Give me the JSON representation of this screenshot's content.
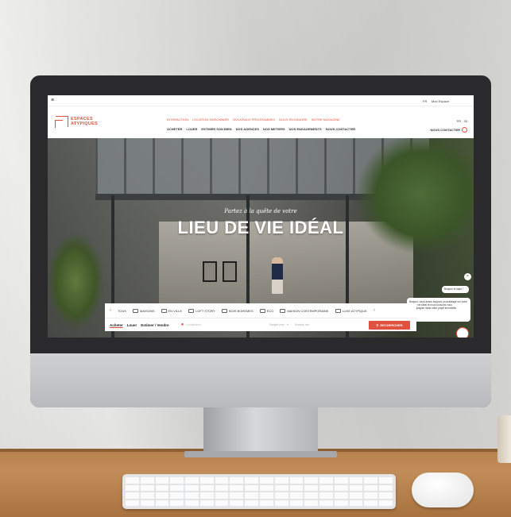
{
  "colors": {
    "brand": "#e0523f"
  },
  "util_bar": {
    "menu_icon": "hamburger-icon",
    "lang": "FR",
    "space": "Mon Espace"
  },
  "logo": {
    "line1": "ESPACES",
    "line2": "ATYPIQUES"
  },
  "nav_top": [
    "INTERACTION",
    "LOCATION SAISONNIER",
    "NOUVEAUX PROGRAMMES",
    "NOUS REJOINDRE",
    "NOTRE MAGAZINE"
  ],
  "nav_main": [
    "ACHETER",
    "LOUER",
    "ESTIMER SON BIEN",
    "NOS AGENCES",
    "NOS METIERS",
    "NOS ENGAGEMENTS",
    "NOUS CONTACTER"
  ],
  "nav_right": {
    "tel": "FR · 33",
    "contact": "NOUS CONTACTER"
  },
  "hero": {
    "subtitle": "Partez à la quête de votre",
    "title": "LIEU DE VIE IDÉAL"
  },
  "chat": {
    "top": "Bonjour le lapin !",
    "message": "Bonjour, nous avons toujours un avantage sur votre lieu de vie idéal et nous pouvons vous accompagner dans votre projet immobilier.",
    "close": "×"
  },
  "filters": {
    "prev": "‹",
    "next": "›",
    "items": [
      "TOUS",
      "MAISONS",
      "EN VILLE",
      "LOFT STORY",
      "BOIS BOHEMES",
      "ECO",
      "MAISON CONTEMPORAINE",
      "LUXE ATYPIQUE"
    ]
  },
  "search": {
    "tabs": [
      "Acheter",
      "Louer",
      "Estimer / Vendre"
    ],
    "location_placeholder": "Localisation",
    "budget": "Budget max · ▾",
    "surface": "Surface min",
    "button": "RECHERCHER"
  }
}
